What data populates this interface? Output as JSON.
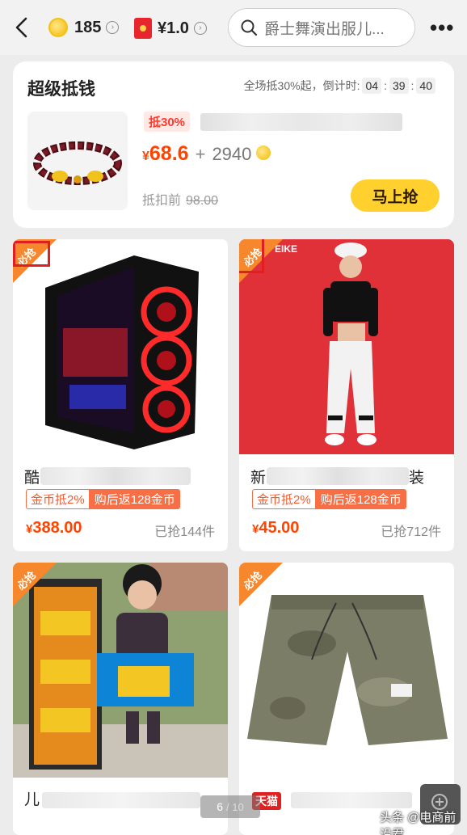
{
  "header": {
    "coins": "185",
    "red_packet": "¥1.0",
    "search_placeholder": "爵士舞演出服儿...",
    "more": "•••"
  },
  "promo": {
    "title": "超级抵钱",
    "timer_label": "全场抵30%起，倒计时:",
    "timer": {
      "h": "04",
      "m": "39",
      "s": "40"
    },
    "badge": "抵30%",
    "price_symbol": "¥",
    "price": "68.6",
    "plus": "+",
    "coins": "2940",
    "orig_label": "抵扣前",
    "orig_price": "98.00",
    "button": "马上抢"
  },
  "products": [
    {
      "corner": "必抢",
      "title_lead": "酷",
      "tag_coin": "金币抵2%",
      "tag_return": "购后返128金币",
      "price_symbol": "¥",
      "price": "388.00",
      "sold": "已抢144件",
      "highlighted": true
    },
    {
      "corner": "必抢",
      "title_lead": "新",
      "title_tail": "装",
      "tag_coin": "金币抵2%",
      "tag_return": "购后返128金币",
      "price_symbol": "¥",
      "price": "45.00",
      "sold": "已抢712件",
      "highlighted": true
    },
    {
      "corner": "必抢",
      "title_lead": "儿"
    },
    {
      "corner": "必抢",
      "badge": "天猫"
    }
  ],
  "pager": {
    "current": "6",
    "total": "/ 10"
  },
  "watermark": "头条 @电商前沿君",
  "colors": {
    "accent": "#ff4400",
    "corner": "#f7872c",
    "button": "#ffd02e"
  }
}
